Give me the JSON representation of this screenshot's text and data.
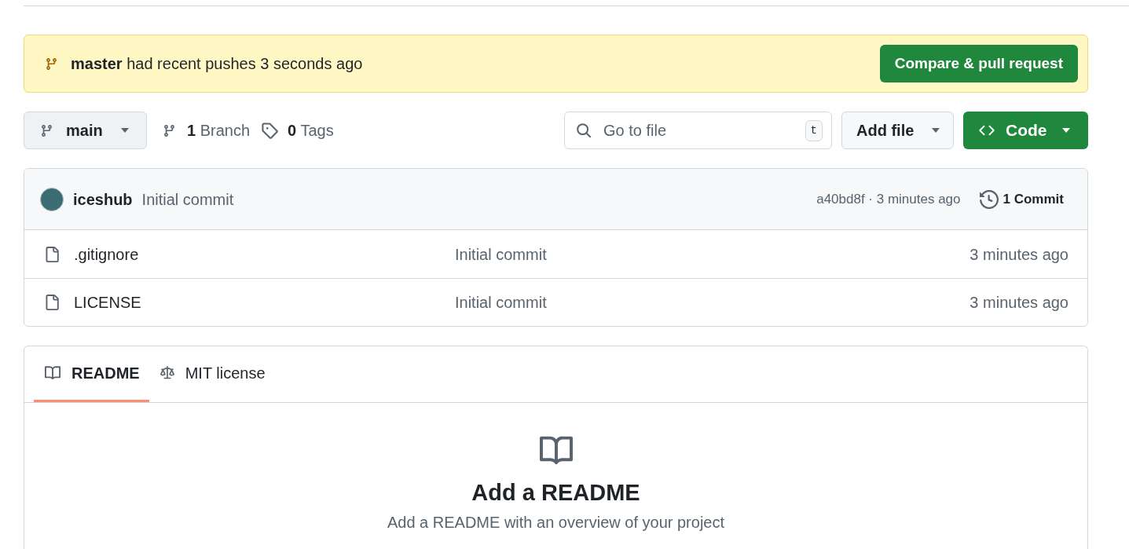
{
  "push_banner": {
    "message": "**master** had recent pushes 3 seconds ago",
    "button": "Compare & pull request"
  },
  "toolbar": {
    "branch_selector": "main",
    "branches": "**1** Branch",
    "tags": "**0** Tags",
    "search": {
      "placeholder": "Go to file",
      "shortcut": "t"
    },
    "add_file": "Add file",
    "code": "Code"
  },
  "latest_commit": {
    "author": "iceshub",
    "message": "Initial commit",
    "hash": "a40bd8f · 3 minutes ago",
    "commits": "1 Commit"
  },
  "files": [
    {
      "name": ".gitignore",
      "commit": "Initial commit",
      "time": "3 minutes ago"
    },
    {
      "name": "LICENSE",
      "commit": "Initial commit",
      "time": "3 minutes ago"
    }
  ],
  "readme_tabs": [
    {
      "label": "README",
      "kind": "book",
      "selected": true
    },
    {
      "label": "MIT license",
      "kind": "scale",
      "selected": false
    }
  ],
  "readme": {
    "title": "Add a README",
    "description": "Add a README with an overview of your project"
  }
}
